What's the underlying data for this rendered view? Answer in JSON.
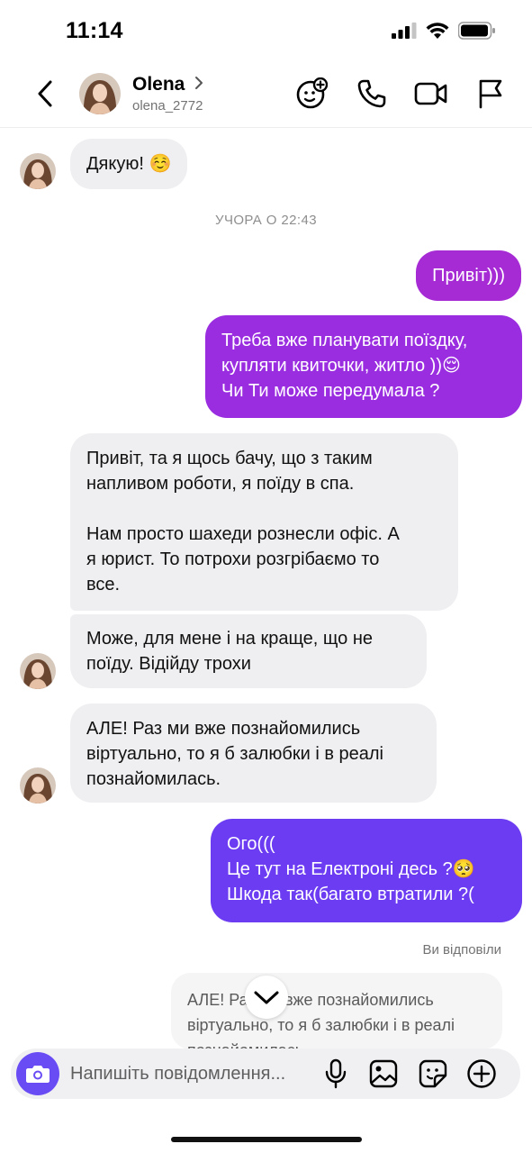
{
  "status_bar": {
    "time": "11:14"
  },
  "header": {
    "name": "Olena",
    "username": "olena_2772"
  },
  "messages": {
    "m1": "Дякую! ☺️",
    "day_separator": "УЧОРА О 22:43",
    "m2": "Привіт)))",
    "m3": "Треба вже планувати поїздку,\nкупляти квиточки, житло ))😌\nЧи Ти може передумала ?",
    "m4": "Привіт, та я щось бачу, що з таким\nнапливом роботи, я поїду в спа.\n\nНам просто шахеди рознесли офіс. А\nя юрист. То потрохи розгрібаємо то\nвсе.",
    "m5": "Може, для мене і на краще, що не\nпоїду. Відійду трохи",
    "m6": "АЛЕ! Раз ми вже познайомились\nвіртуально, то я б залюбки і в реалі\nпознайомилась.",
    "m7": "Ого(((\nЦе тут на Електроні десь ?🥺\nШкода так(багато втратили ?("
  },
  "reply": {
    "label": "Ви відповіли",
    "quoted": "АЛЕ! Раз ми вже познайомились\nвіртуально, то я б залюбки і в реалі\nпознайомилась."
  },
  "composer": {
    "placeholder": "Напишіть повідомлення..."
  },
  "colors": {
    "outgoing_top": "#a52bd6",
    "outgoing_mid": "#8a2eeb",
    "outgoing_bottom": "#6d3df2",
    "incoming": "#efeff1",
    "camera": "#6a4cf5"
  }
}
